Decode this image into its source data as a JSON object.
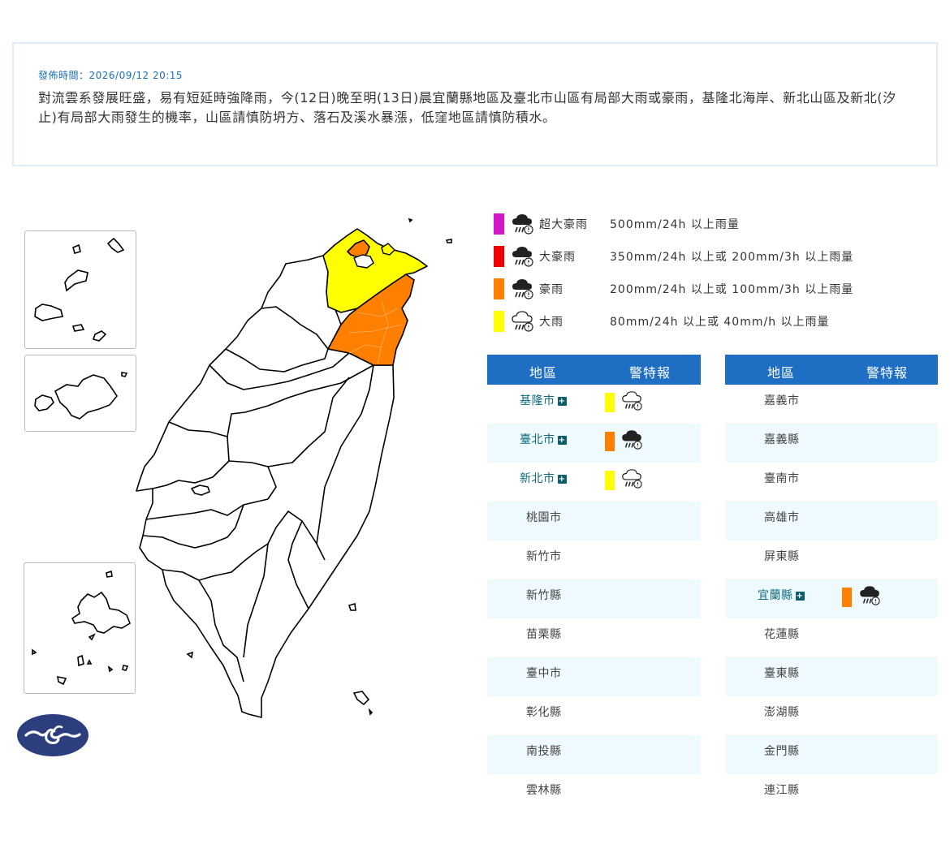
{
  "notice": {
    "time": "發佈時間：2026/09/12 20:15",
    "body": "對流雲系發展旺盛，易有短延時強降雨，今(12日)晚至明(13日)晨宜蘭縣地區及臺北市山區有局部大雨或豪雨，基隆北海岸、新北山區及新北(汐止)有局部大雨發生的機率，山區請慎防坍方、落石及溪水暴漲，低窪地區請慎防積水。"
  },
  "colors": {
    "super_torrential": "#d417c9",
    "extremely_heavy": "#f00000",
    "torrential": "#ff7f00",
    "heavy": "#ffff00",
    "header_blue": "#1e6fc4",
    "row_alt": "#eefafd",
    "logo": "#2d3e7e"
  },
  "legend": [
    {
      "level": "super_torrential",
      "name": "超大豪雨",
      "desc": "500mm/24h 以上雨量",
      "icon": "storm-rain-icon"
    },
    {
      "level": "extremely_heavy",
      "name": "大豪雨",
      "desc": "350mm/24h 以上或 200mm/3h 以上雨量",
      "icon": "storm-rain-icon"
    },
    {
      "level": "torrential",
      "name": "豪雨",
      "desc": "200mm/24h 以上或 100mm/3h 以上雨量",
      "icon": "storm-rain-icon"
    },
    {
      "level": "heavy",
      "name": "大雨",
      "desc": "80mm/24h 以上或 40mm/h 以上雨量",
      "icon": "heavy-rain-icon"
    }
  ],
  "table_headers": {
    "area": "地區",
    "warning": "警特報"
  },
  "table_left": [
    {
      "area": "基隆市",
      "warning": "heavy",
      "link": true
    },
    {
      "area": "臺北市",
      "warning": "torrential",
      "link": true
    },
    {
      "area": "新北市",
      "warning": "heavy",
      "link": true
    },
    {
      "area": "桃園市",
      "warning": "",
      "link": false
    },
    {
      "area": "新竹市",
      "warning": "",
      "link": false
    },
    {
      "area": "新竹縣",
      "warning": "",
      "link": false
    },
    {
      "area": "苗栗縣",
      "warning": "",
      "link": false
    },
    {
      "area": "臺中市",
      "warning": "",
      "link": false
    },
    {
      "area": "彰化縣",
      "warning": "",
      "link": false
    },
    {
      "area": "南投縣",
      "warning": "",
      "link": false
    },
    {
      "area": "雲林縣",
      "warning": "",
      "link": false
    }
  ],
  "table_right": [
    {
      "area": "嘉義市",
      "warning": "",
      "link": false
    },
    {
      "area": "嘉義縣",
      "warning": "",
      "link": false
    },
    {
      "area": "臺南市",
      "warning": "",
      "link": false
    },
    {
      "area": "高雄市",
      "warning": "",
      "link": false
    },
    {
      "area": "屏東縣",
      "warning": "",
      "link": false
    },
    {
      "area": "宜蘭縣",
      "warning": "torrential",
      "link": true
    },
    {
      "area": "花蓮縣",
      "warning": "",
      "link": false
    },
    {
      "area": "臺東縣",
      "warning": "",
      "link": false
    },
    {
      "area": "澎湖縣",
      "warning": "",
      "link": false
    },
    {
      "area": "金門縣",
      "warning": "",
      "link": false
    },
    {
      "area": "連江縣",
      "warning": "",
      "link": false
    }
  ],
  "map_regions": [
    {
      "name": "臺北市",
      "warning": "torrential"
    },
    {
      "name": "新北市",
      "warning": "heavy"
    },
    {
      "name": "基隆市",
      "warning": "heavy"
    },
    {
      "name": "宜蘭縣",
      "warning": "torrential"
    }
  ]
}
